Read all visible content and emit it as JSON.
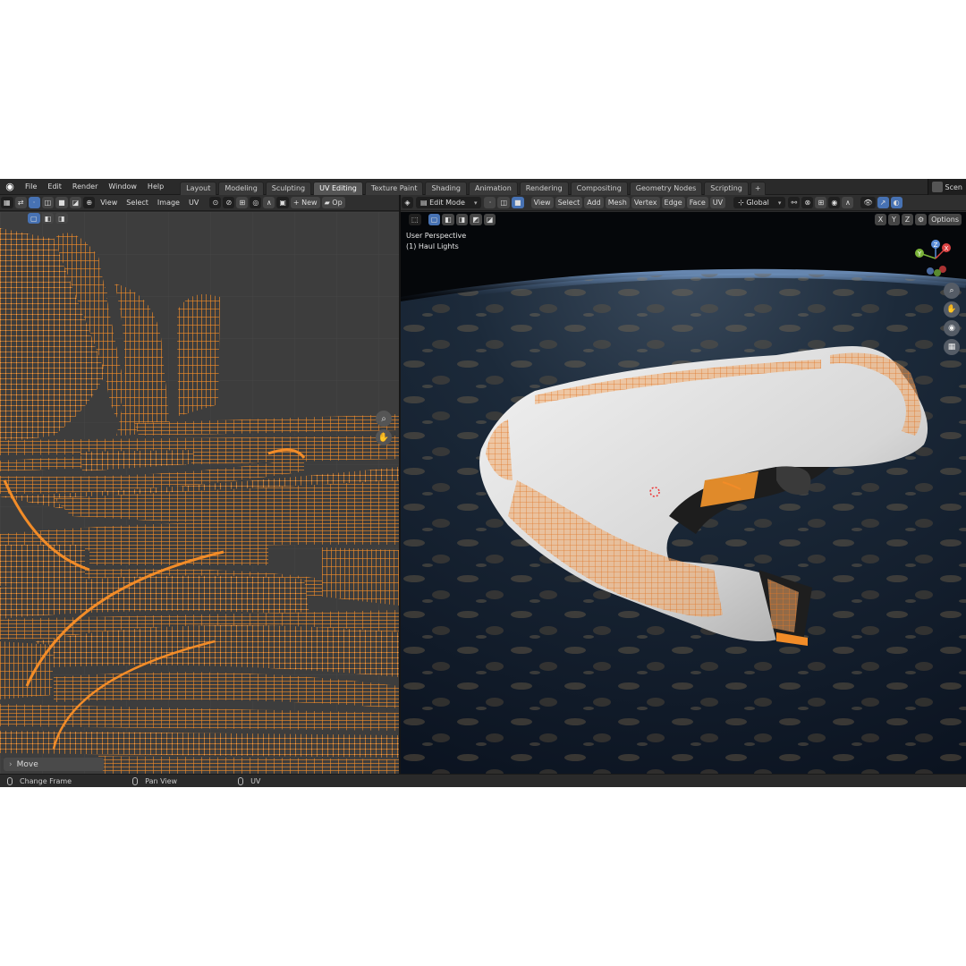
{
  "menu": [
    "File",
    "Edit",
    "Render",
    "Window",
    "Help"
  ],
  "workspace_tabs": [
    {
      "label": "Layout",
      "active": false
    },
    {
      "label": "Modeling",
      "active": false
    },
    {
      "label": "Sculpting",
      "active": false
    },
    {
      "label": "UV Editing",
      "active": true
    },
    {
      "label": "Texture Paint",
      "active": false
    },
    {
      "label": "Shading",
      "active": false
    },
    {
      "label": "Animation",
      "active": false
    },
    {
      "label": "Rendering",
      "active": false
    },
    {
      "label": "Compositing",
      "active": false
    },
    {
      "label": "Geometry Nodes",
      "active": false
    },
    {
      "label": "Scripting",
      "active": false
    }
  ],
  "add_tab": "+",
  "scene_label": "Scen",
  "uv_header": {
    "menus": [
      "View",
      "Select",
      "Image",
      "UV"
    ],
    "new_button": "New",
    "open_button": "Op",
    "plus": "+"
  },
  "uv_editor": {
    "move_panel": "Move",
    "accent_color": "#f28c28"
  },
  "viewport_header": {
    "mode": "Edit Mode",
    "menus": [
      "View",
      "Select",
      "Add",
      "Mesh",
      "Vertex",
      "Edge",
      "Face",
      "UV"
    ],
    "orientation": "Global"
  },
  "viewport": {
    "perspective": "User Perspective",
    "object": "(1) Haul Lights",
    "axes": [
      "X",
      "Y",
      "Z"
    ],
    "options": "Options",
    "gizmo": {
      "x": "X",
      "y": "Y",
      "z": "Z"
    }
  },
  "status_bar": [
    {
      "icon": "mouse-left-icon",
      "label": "Change Frame"
    },
    {
      "icon": "mouse-middle-icon",
      "label": "Pan View"
    },
    {
      "icon": "mouse-right-icon",
      "label": "UV"
    }
  ]
}
